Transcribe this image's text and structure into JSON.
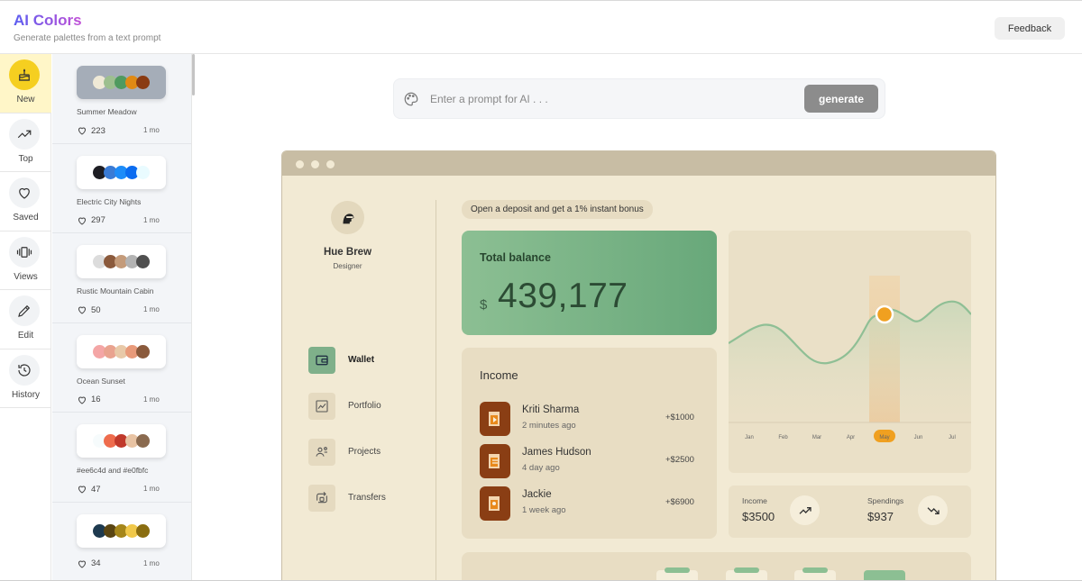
{
  "header": {
    "title": "AI Colors",
    "subtitle": "Generate palettes from a text prompt",
    "feedback_label": "Feedback"
  },
  "nav": {
    "items": [
      {
        "label": "New",
        "icon": "cake-icon",
        "active": true
      },
      {
        "label": "Top",
        "icon": "trending-up-icon"
      },
      {
        "label": "Saved",
        "icon": "heart-icon"
      },
      {
        "label": "Views",
        "icon": "carousel-icon"
      },
      {
        "label": "Edit",
        "icon": "pencil-icon"
      },
      {
        "label": "History",
        "icon": "history-icon"
      }
    ]
  },
  "palettes": [
    {
      "name": "Summer Meadow",
      "likes": "223",
      "age": "1 mo",
      "colors": [
        "#efe9d6",
        "#9dbf8f",
        "#4f9a5f",
        "#e08a14",
        "#8a3b12"
      ]
    },
    {
      "name": "Electric City Nights",
      "likes": "297",
      "age": "1 mo",
      "colors": [
        "#1e1e24",
        "#3a7bd5",
        "#1d8cf8",
        "#0a6cf0",
        "#e9fbff"
      ]
    },
    {
      "name": "Rustic Mountain Cabin",
      "likes": "50",
      "age": "1 mo",
      "colors": [
        "#dcdcdc",
        "#8b5a3c",
        "#c49b7a",
        "#b3b3b3",
        "#4f4f4f"
      ]
    },
    {
      "name": "Ocean Sunset",
      "likes": "16",
      "age": "1 mo",
      "colors": [
        "#f4a6a6",
        "#e9a38f",
        "#e8c9a8",
        "#e89a7a",
        "#8a5a3c"
      ]
    },
    {
      "name": "#ee6c4d and #e0fbfc",
      "likes": "47",
      "age": "1 mo",
      "colors": [
        "#f6fbfc",
        "#ee6c4d",
        "#c0392b",
        "#e8c3a3",
        "#8a6a4f"
      ]
    },
    {
      "name": "",
      "likes": "34",
      "age": "1 mo",
      "colors": [
        "#1e3a4f",
        "#5a4512",
        "#a5861a",
        "#f0c84a",
        "#8a6d10"
      ]
    }
  ],
  "prompt": {
    "placeholder": "Enter a prompt for AI . . .",
    "generate_label": "generate"
  },
  "mock": {
    "user": {
      "name": "Hue Brew",
      "role": "Designer"
    },
    "menu": [
      {
        "label": "Wallet",
        "icon": "wallet-icon",
        "active": true
      },
      {
        "label": "Portfolio",
        "icon": "chart-icon"
      },
      {
        "label": "Projects",
        "icon": "users-icon"
      },
      {
        "label": "Transfers",
        "icon": "transfer-icon"
      }
    ],
    "promo": "Open a deposit and get a 1% instant bonus",
    "balance": {
      "title": "Total balance",
      "currency": "$",
      "amount": "439,177"
    },
    "income": {
      "title": "Income",
      "rows": [
        {
          "name": "Kriti Sharma",
          "time": "2 minutes ago",
          "amount": "+$1000"
        },
        {
          "name": "James Hudson",
          "time": "4 day ago",
          "amount": "+$2500"
        },
        {
          "name": "Jackie",
          "time": "1 week ago",
          "amount": "+$6900"
        }
      ]
    },
    "chart_data": {
      "type": "area",
      "categories": [
        "Jan",
        "Feb",
        "Mar",
        "Apr",
        "May",
        "Jun",
        "Jul"
      ],
      "highlight": "May"
    },
    "stats": {
      "income_label": "Income",
      "income_value": "$3500",
      "spendings_label": "Spendings",
      "spendings_value": "$937"
    }
  },
  "colors": {
    "accent_yellow": "#f5cf20",
    "mock_bg": "#f2ead4",
    "mock_green": "#7fb08a",
    "chart_highlight": "#f0a020"
  }
}
